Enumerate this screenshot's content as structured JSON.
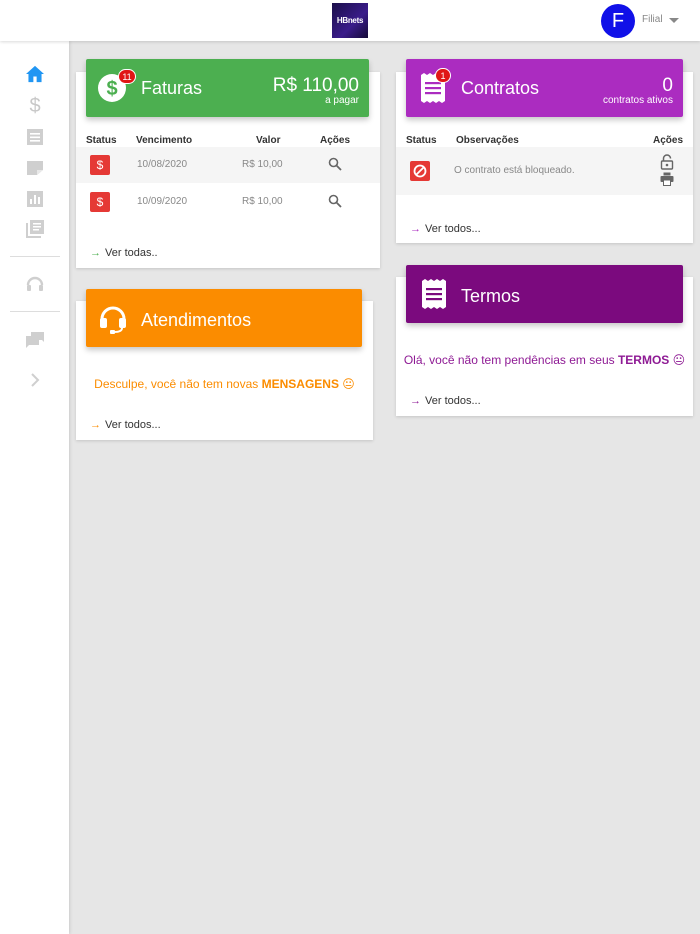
{
  "header": {
    "logo_text": "HBnets",
    "avatar_letter": "F",
    "user_label": "Filial"
  },
  "colors": {
    "faturas": "#4caf50",
    "contratos": "#ab2cc0",
    "atendimentos": "#fb8c00",
    "termos": "#7b0a7e",
    "active_nav": "#2196f3",
    "danger": "#e53935"
  },
  "sidebar": {
    "items": [
      {
        "icon": "home-icon",
        "active": true
      },
      {
        "icon": "dollar-icon"
      },
      {
        "icon": "document-icon"
      },
      {
        "icon": "note-icon"
      },
      {
        "icon": "chart-icon"
      },
      {
        "icon": "library-icon"
      },
      {
        "icon": "headset-icon"
      },
      {
        "icon": "chat-icon"
      },
      {
        "icon": "chevron-right-icon"
      }
    ]
  },
  "faturas": {
    "title": "Faturas",
    "badge": "11",
    "amount": "R$ 110,00",
    "amount_sub": "a pagar",
    "columns": [
      "Status",
      "Vencimento",
      "Valor",
      "Ações"
    ],
    "rows": [
      {
        "vencimento": "10/08/2020",
        "valor": "R$ 10,00"
      },
      {
        "vencimento": "10/09/2020",
        "valor": "R$ 10,00"
      }
    ],
    "link": "Ver todas.."
  },
  "contratos": {
    "title": "Contratos",
    "badge": "1",
    "count": "0",
    "count_sub": "contratos ativos",
    "columns": [
      "Status",
      "Observações",
      "Ações"
    ],
    "rows": [
      {
        "observacao": "O contrato está bloqueado."
      }
    ],
    "link": "Ver todos..."
  },
  "atendimentos": {
    "title": "Atendimentos",
    "message_prefix": "Desculpe, você não tem novas ",
    "message_bold": "MENSAGENS",
    "emoji": "😐",
    "link": "Ver todos..."
  },
  "termos": {
    "title": "Termos",
    "message_prefix": "Olá, você não tem pendências em seus ",
    "message_bold": "TERMOS",
    "emoji": "😐",
    "link": "Ver todos..."
  },
  "arrow": "→"
}
